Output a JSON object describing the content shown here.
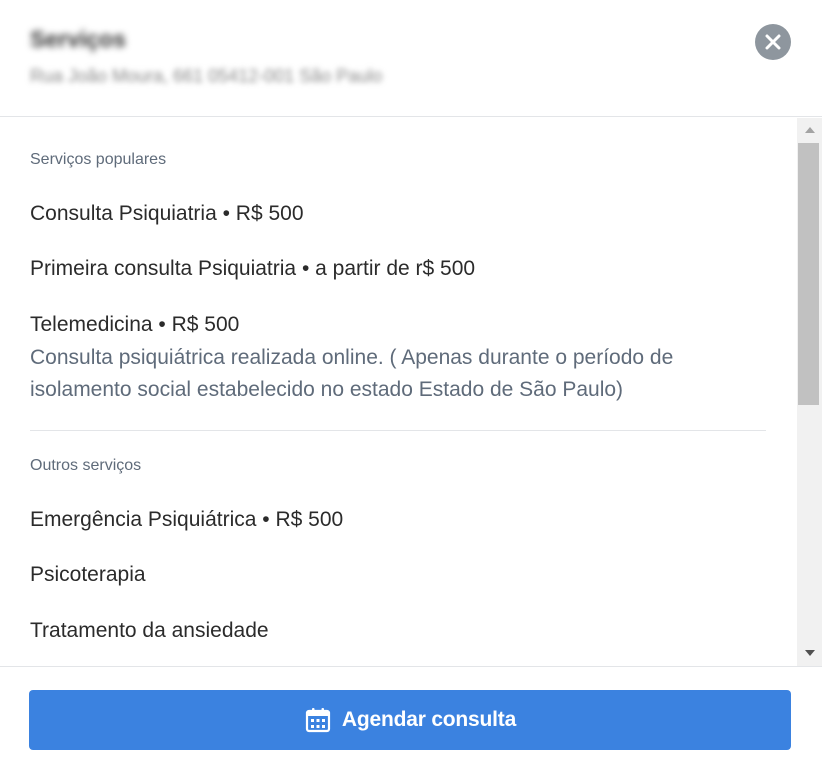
{
  "header": {
    "title": "Serviços",
    "subtitle": "Rua João Moura, 661 05412-001 São Paulo"
  },
  "sections": {
    "popular": {
      "label": "Serviços populares",
      "items": [
        {
          "text": "Consulta Psiquiatria • R$ 500"
        },
        {
          "text": "Primeira consulta Psiquiatria • a partir de r$ 500"
        },
        {
          "text": "Telemedicina • R$ 500",
          "description": "Consulta psiquiátrica realizada online. ( Apenas durante o período de isolamento social estabelecido no estado Estado de São Paulo)"
        }
      ]
    },
    "others": {
      "label": "Outros serviços",
      "items": [
        {
          "text": "Emergência Psiquiátrica • R$ 500"
        },
        {
          "text": "Psicoterapia"
        },
        {
          "text": "Tratamento da ansiedade"
        }
      ]
    }
  },
  "footer": {
    "cta_label": "Agendar consulta",
    "cta_icon": "calendar-icon"
  },
  "colors": {
    "accent": "#3b82e0",
    "close_bg": "#8e969e",
    "muted_text": "#5f6b7a"
  }
}
